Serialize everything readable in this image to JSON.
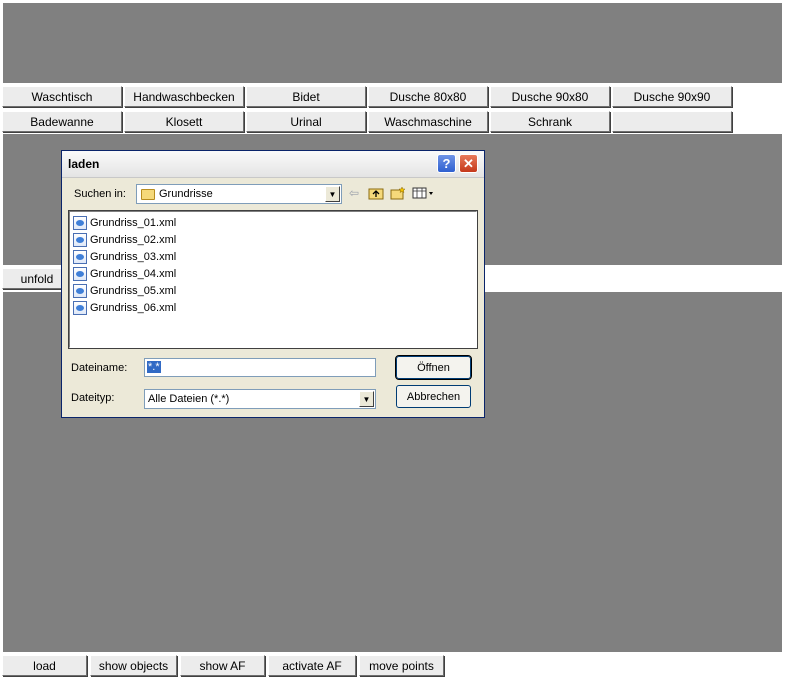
{
  "toolbar_row1": [
    "Waschtisch",
    "Handwaschbecken",
    "Bidet",
    "Dusche 80x80",
    "Dusche 90x80",
    "Dusche 90x90"
  ],
  "toolbar_row2": [
    "Badewanne",
    "Klosett",
    "Urinal",
    "Waschmaschine",
    "Schrank",
    ""
  ],
  "unfold_label": "unfold",
  "bottom_bar": [
    "load",
    "show objects",
    "show AF",
    "activate AF",
    "move points"
  ],
  "dialog": {
    "title": "laden",
    "help_glyph": "?",
    "close_glyph": "✕",
    "look_in_label": "Suchen in:",
    "look_in_value": "Grundrisse",
    "files": [
      "Grundriss_01.xml",
      "Grundriss_02.xml",
      "Grundriss_03.xml",
      "Grundriss_04.xml",
      "Grundriss_05.xml",
      "Grundriss_06.xml"
    ],
    "filename_label": "Dateiname:",
    "filename_value": "*.*",
    "filetype_label": "Dateityp:",
    "filetype_value": "Alle Dateien (*.*)",
    "open_button": "Öffnen",
    "cancel_button": "Abbrechen"
  },
  "icons": {
    "back": "back-arrow-icon",
    "up": "up-folder-icon",
    "new_folder": "new-folder-icon",
    "view_menu": "view-menu-icon"
  }
}
